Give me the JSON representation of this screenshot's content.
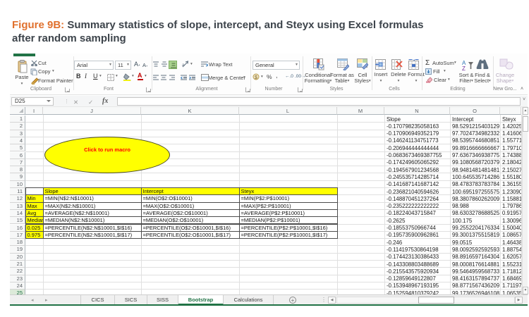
{
  "caption": {
    "prefix": "Figure 9B:",
    "text": "Summary statistics of slope, intercept, and Steyx using Excel formulas after random sampling"
  },
  "ribbon": {
    "clipboard": {
      "label": "Clipboard",
      "paste": "Paste",
      "cut": "Cut",
      "copy": "Copy",
      "format_painter": "Format Painter"
    },
    "font": {
      "label": "Font",
      "font_name": "Arial",
      "font_size": "11",
      "bold": "B",
      "italic": "I",
      "underline": "U"
    },
    "alignment": {
      "label": "Alignment",
      "wrap_text": "Wrap Text",
      "merge_center": "Merge & Center"
    },
    "number": {
      "label": "Number",
      "format": "General",
      "percent": "%",
      "comma": ",",
      "inc_dec": ".0",
      "dec_dec": ".00"
    },
    "styles": {
      "label": "Styles",
      "conditional_1": "Conditional",
      "conditional_2": "Formatting",
      "table_1": "Format as",
      "table_2": "Table",
      "cellstyles_1": "Cell",
      "cellstyles_2": "Styles"
    },
    "cells": {
      "label": "Cells",
      "insert": "Insert",
      "delete": "Delete",
      "format": "Format"
    },
    "editing": {
      "label": "Editing",
      "autosum": "AutoSum",
      "fill": "Fill",
      "clear": "Clear",
      "sort_1": "Sort &",
      "sort_2": "Filter",
      "find_1": "Find &",
      "find_2": "Select"
    },
    "new_group": {
      "label": "New Gro...",
      "shape_1": "Change",
      "shape_2": "Shape"
    }
  },
  "formula_bar": {
    "name_box": "D25",
    "fx": "fx",
    "formula": ""
  },
  "grid": {
    "column_letters": [
      "I",
      "J",
      "K",
      "L",
      "M",
      "N",
      "O",
      ""
    ],
    "row_count": 25,
    "selected_row": 25
  },
  "sheet": {
    "macro_button": {
      "text": "Click to run macro"
    },
    "data_headers": [
      "Slope",
      "Intercept",
      "Steyx"
    ],
    "data_rows": [
      [
        "-0.170798235058163",
        "98.5291215403129",
        "1.42025"
      ],
      [
        "-0.170906949352179",
        "97.7024734982332",
        "1.41606"
      ],
      [
        "-0.146241134751773",
        "98.5395744680851",
        "1.55771"
      ],
      [
        "-0.206944444444444",
        "99.8916666666667",
        "1.79710"
      ],
      [
        "-0.0683673469387755",
        "97.6367346938775",
        "1.74388"
      ],
      [
        "-0.174249605065292",
        "99.1080568720379",
        "2.18042"
      ],
      [
        "-0.194567901234568",
        "98.9481481481481",
        "2.15027"
      ],
      [
        "-0.245535714285714",
        "100.645535714286",
        "1.55180"
      ],
      [
        "-0.141687141687142",
        "98.4783783783784",
        "1.36155"
      ],
      [
        "-0.236821040594626",
        "100.695197255575",
        "1.23090"
      ],
      [
        "-0.148870451237264",
        "98.3807860262009",
        "1.15881"
      ],
      [
        "-0.235222222222222",
        "98.988",
        "1.79786"
      ],
      [
        "-0.18224043715847",
        "98.6303278688525",
        "0.91957"
      ],
      [
        "-0.2625",
        "100.175",
        "1.30096"
      ],
      [
        "-0.18553750966744",
        "99.2552204176334",
        "1.50040"
      ],
      [
        "-0.195735900962861",
        "99.3001375515819",
        "1.08657"
      ],
      [
        "-0.246",
        "99.0515",
        "1.46438"
      ],
      [
        "-0.114197530864198",
        "98.0092592592593",
        "1.88754"
      ],
      [
        "-0.174423130386433",
        "98.8916597164304",
        "1.62057"
      ],
      [
        "-0.143308803488689",
        "98.0008176614881",
        "1.55231"
      ],
      [
        "-0.215543575920934",
        "99.5464959568733",
        "1.71812"
      ],
      [
        "-0.12859649122807",
        "98.4163157894737",
        "1.68469"
      ],
      [
        "-0.153948967193195",
        "98.8771567436209",
        "1.71197"
      ],
      [
        "-0.152594810379242",
        "99.1736526946108",
        "1.06535"
      ]
    ],
    "summary_table": {
      "headers": [
        "Slope",
        "Intercept",
        "Steyx"
      ],
      "row_labels": [
        "Min",
        "Max",
        "Avg",
        "Median",
        "0.025",
        "0.975"
      ],
      "formulas": [
        [
          "=MIN(N$2:N$10001)",
          "=MIN(O$2:O$10001)",
          "=MIN(P$2:P$10001)"
        ],
        [
          "=MAX(N$2:N$10001)",
          "=MAX(O$2:O$10001)",
          "=MAX(P$2:P$10001)"
        ],
        [
          "=AVERAGE(N$2:N$10001)",
          "=AVERAGE(O$2:O$10001)",
          "=AVERAGE(P$2:P$10001)"
        ],
        [
          "=MEDIAN(N$2:N$10001)",
          "=MEDIAN(O$2:O$10001)",
          "=MEDIAN(P$2:P$10001)"
        ],
        [
          "=PERCENTILE(N$2:N$10001,$I$16)",
          "=PERCENTILE(O$2:O$10001,$I$16)",
          "=PERCENTILE(P$2:P$10001,$I$16)"
        ],
        [
          "=PERCENTILE(N$2:N$10001,$I$17)",
          "=PERCENTILE(O$2:O$10001,$I$17)",
          "=PERCENTILE(P$2:P$10001,$I$17)"
        ]
      ]
    }
  },
  "tabs": {
    "items": [
      "CICS",
      "SICS",
      "SISS",
      "Bootstrap",
      "Calculations"
    ],
    "active": "Bootstrap"
  },
  "colors": {
    "excel_green": "#217346",
    "highlight_yellow": "#ffff00",
    "macro_text_red": "#ff0000",
    "caption_orange": "#e0712e"
  }
}
